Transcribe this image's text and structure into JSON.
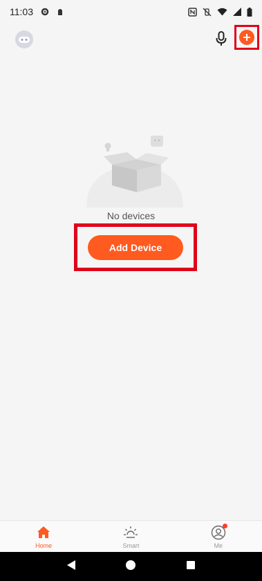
{
  "status_bar": {
    "time": "11:03",
    "left_icons": [
      "settings-icon",
      "app-notification-icon"
    ],
    "right_icons": [
      "nfc-icon",
      "vibrate-off-icon",
      "wifi-icon",
      "signal-icon",
      "battery-icon"
    ]
  },
  "header": {
    "avatar_icon": "robot-avatar-icon",
    "mic_icon": "microphone-icon",
    "add_icon": "add-plus-icon"
  },
  "empty_state": {
    "message": "No devices",
    "button_label": "Add Device"
  },
  "tabs": [
    {
      "label": "Home",
      "icon": "home-icon",
      "active": true
    },
    {
      "label": "Smart",
      "icon": "sun-icon",
      "active": false
    },
    {
      "label": "Me",
      "icon": "profile-icon",
      "active": false,
      "badge": true
    }
  ],
  "colors": {
    "accent": "#ff5a1f",
    "highlight_frame": "#e0001b",
    "background": "#f5f5f5"
  }
}
